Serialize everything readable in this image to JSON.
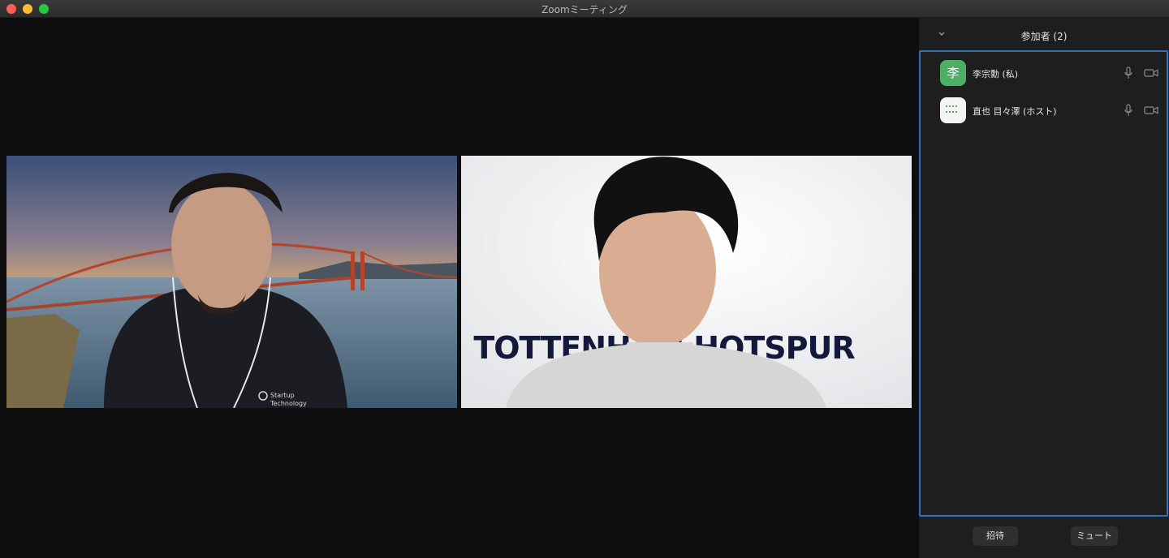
{
  "window": {
    "title": "Zoomミーティング"
  },
  "participants_panel": {
    "title": "参加者 (2)",
    "participants": [
      {
        "name": "李宗勳 (私)",
        "avatar_text": "李",
        "avatar_color": "#4caf63"
      },
      {
        "name": "直也 目々澤 (ホスト)",
        "avatar_text": "",
        "avatar_color": "#f4f4f4"
      }
    ],
    "buttons": {
      "invite": "招待",
      "mute_all": "ミュート"
    }
  },
  "videos": [
    {
      "background": "golden-gate-bridge-sunset",
      "shirt_logo": [
        "Startup",
        "Technology"
      ]
    },
    {
      "background": "TOTTENHAM HOTSPUR",
      "banner_text": "TOTTENHAM HOTSPUR"
    }
  ],
  "colors": {
    "accent_border": "#2f6fbf",
    "avatar_green": "#4caf63",
    "panel_bg": "#1e1e1e"
  }
}
